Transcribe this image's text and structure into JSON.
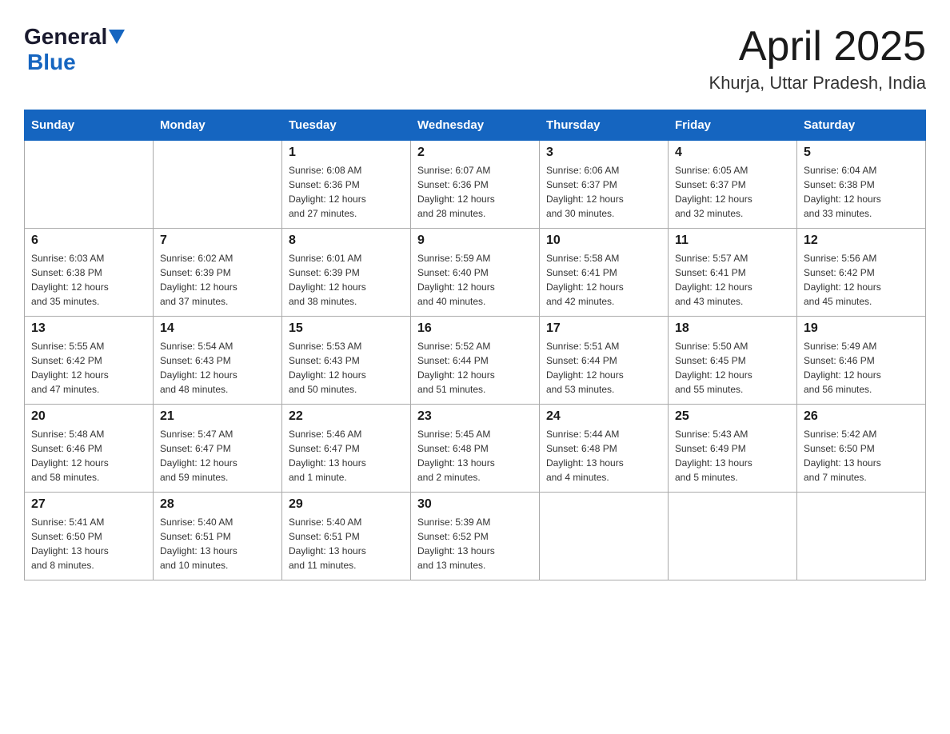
{
  "header": {
    "logo_general": "General",
    "logo_blue": "Blue",
    "title": "April 2025",
    "subtitle": "Khurja, Uttar Pradesh, India"
  },
  "calendar": {
    "days_of_week": [
      "Sunday",
      "Monday",
      "Tuesday",
      "Wednesday",
      "Thursday",
      "Friday",
      "Saturday"
    ],
    "weeks": [
      [
        {
          "day": "",
          "info": ""
        },
        {
          "day": "",
          "info": ""
        },
        {
          "day": "1",
          "info": "Sunrise: 6:08 AM\nSunset: 6:36 PM\nDaylight: 12 hours\nand 27 minutes."
        },
        {
          "day": "2",
          "info": "Sunrise: 6:07 AM\nSunset: 6:36 PM\nDaylight: 12 hours\nand 28 minutes."
        },
        {
          "day": "3",
          "info": "Sunrise: 6:06 AM\nSunset: 6:37 PM\nDaylight: 12 hours\nand 30 minutes."
        },
        {
          "day": "4",
          "info": "Sunrise: 6:05 AM\nSunset: 6:37 PM\nDaylight: 12 hours\nand 32 minutes."
        },
        {
          "day": "5",
          "info": "Sunrise: 6:04 AM\nSunset: 6:38 PM\nDaylight: 12 hours\nand 33 minutes."
        }
      ],
      [
        {
          "day": "6",
          "info": "Sunrise: 6:03 AM\nSunset: 6:38 PM\nDaylight: 12 hours\nand 35 minutes."
        },
        {
          "day": "7",
          "info": "Sunrise: 6:02 AM\nSunset: 6:39 PM\nDaylight: 12 hours\nand 37 minutes."
        },
        {
          "day": "8",
          "info": "Sunrise: 6:01 AM\nSunset: 6:39 PM\nDaylight: 12 hours\nand 38 minutes."
        },
        {
          "day": "9",
          "info": "Sunrise: 5:59 AM\nSunset: 6:40 PM\nDaylight: 12 hours\nand 40 minutes."
        },
        {
          "day": "10",
          "info": "Sunrise: 5:58 AM\nSunset: 6:41 PM\nDaylight: 12 hours\nand 42 minutes."
        },
        {
          "day": "11",
          "info": "Sunrise: 5:57 AM\nSunset: 6:41 PM\nDaylight: 12 hours\nand 43 minutes."
        },
        {
          "day": "12",
          "info": "Sunrise: 5:56 AM\nSunset: 6:42 PM\nDaylight: 12 hours\nand 45 minutes."
        }
      ],
      [
        {
          "day": "13",
          "info": "Sunrise: 5:55 AM\nSunset: 6:42 PM\nDaylight: 12 hours\nand 47 minutes."
        },
        {
          "day": "14",
          "info": "Sunrise: 5:54 AM\nSunset: 6:43 PM\nDaylight: 12 hours\nand 48 minutes."
        },
        {
          "day": "15",
          "info": "Sunrise: 5:53 AM\nSunset: 6:43 PM\nDaylight: 12 hours\nand 50 minutes."
        },
        {
          "day": "16",
          "info": "Sunrise: 5:52 AM\nSunset: 6:44 PM\nDaylight: 12 hours\nand 51 minutes."
        },
        {
          "day": "17",
          "info": "Sunrise: 5:51 AM\nSunset: 6:44 PM\nDaylight: 12 hours\nand 53 minutes."
        },
        {
          "day": "18",
          "info": "Sunrise: 5:50 AM\nSunset: 6:45 PM\nDaylight: 12 hours\nand 55 minutes."
        },
        {
          "day": "19",
          "info": "Sunrise: 5:49 AM\nSunset: 6:46 PM\nDaylight: 12 hours\nand 56 minutes."
        }
      ],
      [
        {
          "day": "20",
          "info": "Sunrise: 5:48 AM\nSunset: 6:46 PM\nDaylight: 12 hours\nand 58 minutes."
        },
        {
          "day": "21",
          "info": "Sunrise: 5:47 AM\nSunset: 6:47 PM\nDaylight: 12 hours\nand 59 minutes."
        },
        {
          "day": "22",
          "info": "Sunrise: 5:46 AM\nSunset: 6:47 PM\nDaylight: 13 hours\nand 1 minute."
        },
        {
          "day": "23",
          "info": "Sunrise: 5:45 AM\nSunset: 6:48 PM\nDaylight: 13 hours\nand 2 minutes."
        },
        {
          "day": "24",
          "info": "Sunrise: 5:44 AM\nSunset: 6:48 PM\nDaylight: 13 hours\nand 4 minutes."
        },
        {
          "day": "25",
          "info": "Sunrise: 5:43 AM\nSunset: 6:49 PM\nDaylight: 13 hours\nand 5 minutes."
        },
        {
          "day": "26",
          "info": "Sunrise: 5:42 AM\nSunset: 6:50 PM\nDaylight: 13 hours\nand 7 minutes."
        }
      ],
      [
        {
          "day": "27",
          "info": "Sunrise: 5:41 AM\nSunset: 6:50 PM\nDaylight: 13 hours\nand 8 minutes."
        },
        {
          "day": "28",
          "info": "Sunrise: 5:40 AM\nSunset: 6:51 PM\nDaylight: 13 hours\nand 10 minutes."
        },
        {
          "day": "29",
          "info": "Sunrise: 5:40 AM\nSunset: 6:51 PM\nDaylight: 13 hours\nand 11 minutes."
        },
        {
          "day": "30",
          "info": "Sunrise: 5:39 AM\nSunset: 6:52 PM\nDaylight: 13 hours\nand 13 minutes."
        },
        {
          "day": "",
          "info": ""
        },
        {
          "day": "",
          "info": ""
        },
        {
          "day": "",
          "info": ""
        }
      ]
    ]
  }
}
